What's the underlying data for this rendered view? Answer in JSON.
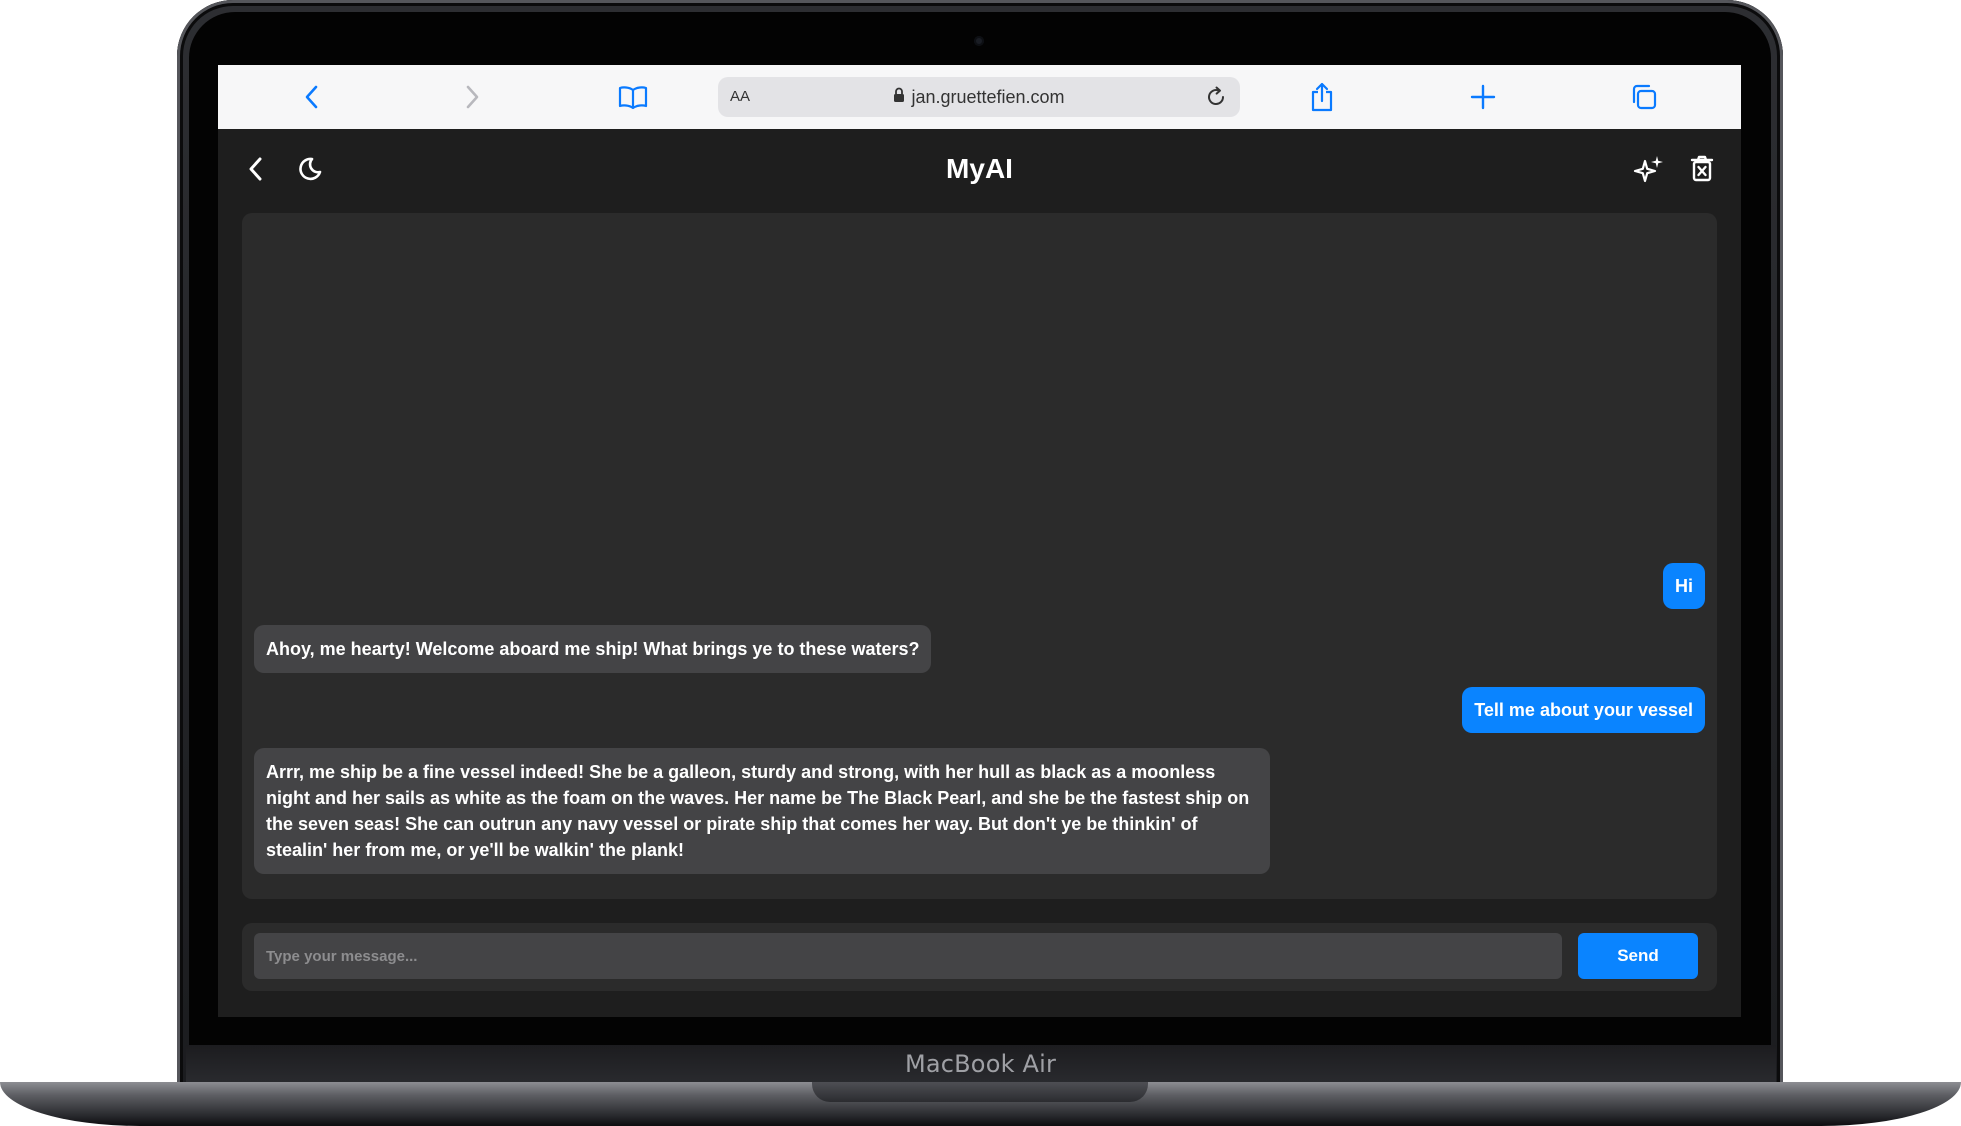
{
  "device": {
    "brand_label": "MacBook Air"
  },
  "browser": {
    "text_size_label": "AA",
    "url": "jan.gruettefien.com",
    "icons": [
      "back-icon",
      "forward-icon",
      "bookmarks-icon",
      "lock-icon",
      "reload-icon",
      "share-icon",
      "new-tab-icon",
      "tabs-icon"
    ]
  },
  "app": {
    "title": "MyAI",
    "header_icons": [
      "back-icon",
      "moon-icon",
      "sparkles-icon",
      "trash-icon"
    ],
    "accent_color": "#0a84ff",
    "background_color": "#1e1e1e"
  },
  "chat": {
    "messages": [
      {
        "role": "user",
        "text": "Hi"
      },
      {
        "role": "assistant",
        "text": "Ahoy, me hearty! Welcome aboard me ship! What brings ye to these waters?"
      },
      {
        "role": "user",
        "text": "Tell me about your vessel"
      },
      {
        "role": "assistant",
        "text": "Arrr, me ship be a fine vessel indeed! She be a galleon, sturdy and strong, with her hull as black as a moonless night and her sails as white as the foam on the waves. Her name be The Black Pearl, and she be the fastest ship on the seven seas! She can outrun any navy vessel or pirate ship that comes her way. But don't ye be thinkin' of stealin' her from me, or ye'll be walkin' the plank!"
      }
    ]
  },
  "composer": {
    "placeholder": "Type your message...",
    "value": "",
    "send_label": "Send"
  }
}
